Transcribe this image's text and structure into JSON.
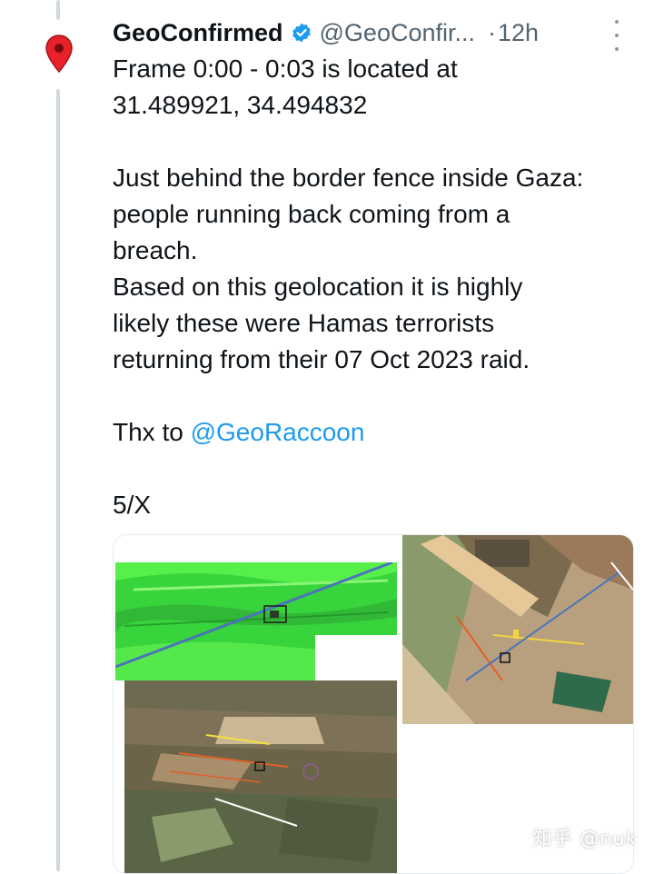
{
  "tweet": {
    "author_name": "GeoConfirmed",
    "author_handle": "@GeoConfir...",
    "separator": "·",
    "timestamp": "12h",
    "lines": [
      "Frame 0:00 - 0:03 is located at",
      "31.489921, 34.494832",
      "Just behind the border fence inside Gaza:",
      "people running back coming from a",
      "breach.",
      "Based on this geolocation it is highly",
      "likely these were Hamas terrorists",
      "returning from their 07 Oct 2023 raid."
    ],
    "thanks_prefix": "Thx to ",
    "thanks_mention": "@GeoRaccoon",
    "thread_counter": "5/X"
  },
  "icons": {
    "avatar": "map-pin-icon",
    "verified": "verified-badge-icon",
    "more": "more-options-icon"
  },
  "colors": {
    "accent": "#1d9bf0",
    "pin_red": "#e8212b",
    "thread_line": "#cfd9de",
    "secondary_text": "#536471"
  },
  "watermark": "知乎 @nuk"
}
